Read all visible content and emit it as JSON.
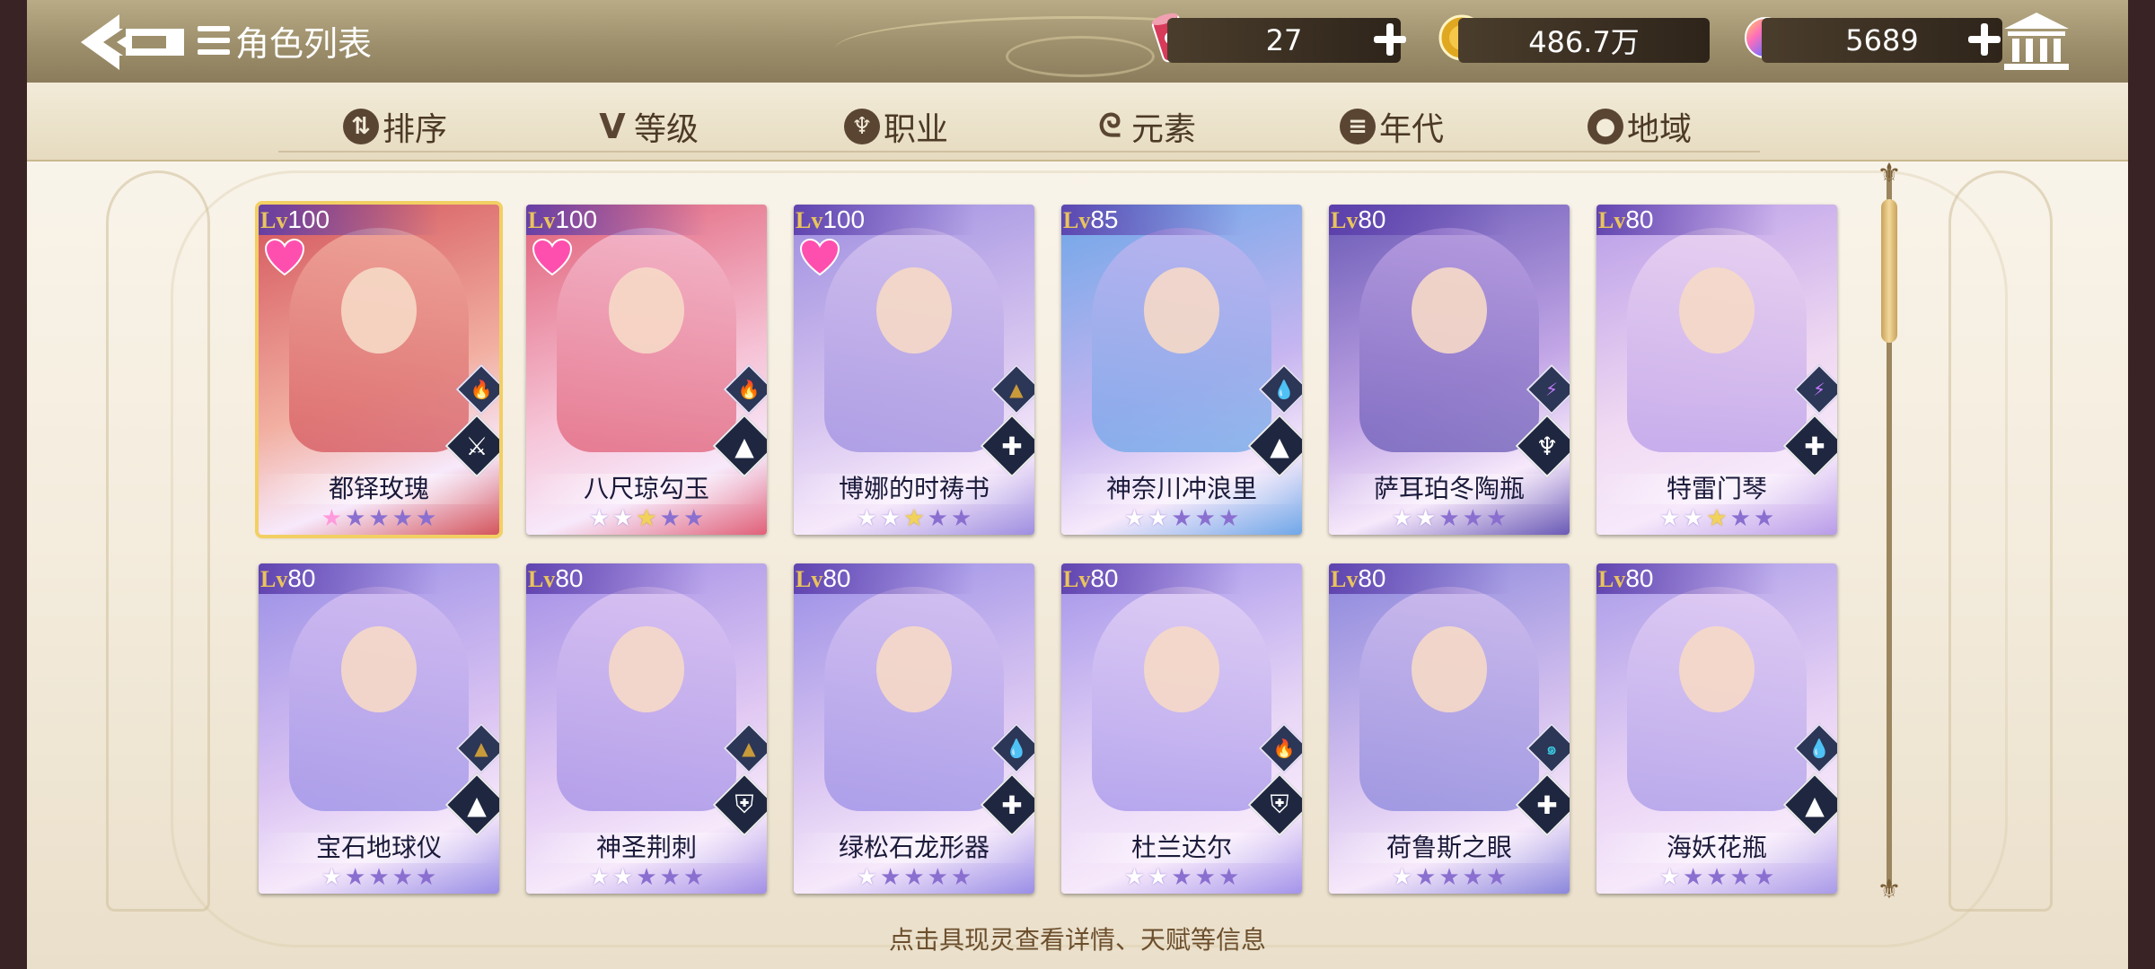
{
  "header": {
    "title": "角色列表",
    "resources": [
      {
        "icon": "stamina-can-icon",
        "value": "27"
      },
      {
        "icon": "gold-coin-icon",
        "value": "486.7万"
      },
      {
        "icon": "rainbow-gem-icon",
        "value": "5689"
      }
    ]
  },
  "filters": [
    {
      "label": "排序",
      "icon": "sort-icon"
    },
    {
      "label": "等级",
      "icon": "level-icon"
    },
    {
      "label": "职业",
      "icon": "class-icon"
    },
    {
      "label": "元素",
      "icon": "element-icon"
    },
    {
      "label": "年代",
      "icon": "era-icon"
    },
    {
      "label": "地域",
      "icon": "region-icon"
    }
  ],
  "cards": [
    {
      "lv_prefix": "Lv",
      "lv": "100",
      "name": "都铎玫瑰",
      "favorite": true,
      "element": "fire",
      "class": "sword",
      "stars": [
        "p",
        "d",
        "d",
        "d",
        "d"
      ],
      "palette": [
        "#d4555c",
        "#f2b0a2"
      ]
    },
    {
      "lv_prefix": "Lv",
      "lv": "100",
      "name": "八尺琼勾玉",
      "favorite": true,
      "element": "fire",
      "class": "book",
      "stars": [
        "w",
        "w",
        "y",
        "d",
        "d"
      ],
      "palette": [
        "#e06078",
        "#f6c3d6"
      ]
    },
    {
      "lv_prefix": "Lv",
      "lv": "100",
      "name": "博娜的时祷书",
      "favorite": true,
      "element": "earth",
      "class": "cross",
      "stars": [
        "w",
        "w",
        "y",
        "d",
        "d"
      ],
      "palette": [
        "#9e8ee0",
        "#d8c6f0"
      ]
    },
    {
      "lv_prefix": "Lv",
      "lv": "85",
      "name": "神奈川冲浪里",
      "favorite": false,
      "element": "water",
      "class": "book",
      "stars": [
        "w",
        "w",
        "d",
        "d",
        "d"
      ],
      "palette": [
        "#6fa7e8",
        "#c6b5f0"
      ]
    },
    {
      "lv_prefix": "Lv",
      "lv": "80",
      "name": "萨耳珀冬陶瓶",
      "favorite": false,
      "element": "thunder",
      "class": "trident",
      "stars": [
        "w",
        "w",
        "d",
        "d",
        "d"
      ],
      "palette": [
        "#6a5ab6",
        "#c2a6e6"
      ]
    },
    {
      "lv_prefix": "Lv",
      "lv": "80",
      "name": "特雷门琴",
      "favorite": false,
      "element": "thunder",
      "class": "cross",
      "stars": [
        "w",
        "w",
        "y",
        "d",
        "d"
      ],
      "palette": [
        "#b89ce8",
        "#f0d9f2"
      ]
    },
    {
      "lv_prefix": "Lv",
      "lv": "80",
      "name": "宝石地球仪",
      "favorite": false,
      "element": "earth",
      "class": "book",
      "stars": [
        "w",
        "d",
        "d",
        "d",
        "d"
      ],
      "palette": [
        "#9a8fe6",
        "#d9c2f2"
      ]
    },
    {
      "lv_prefix": "Lv",
      "lv": "80",
      "name": "神圣荆刺",
      "favorite": false,
      "element": "earth",
      "class": "shield",
      "stars": [
        "w",
        "w",
        "d",
        "d",
        "d"
      ],
      "palette": [
        "#a28fe6",
        "#e1c9f3"
      ]
    },
    {
      "lv_prefix": "Lv",
      "lv": "80",
      "name": "绿松石龙形器",
      "favorite": false,
      "element": "water",
      "class": "cross",
      "stars": [
        "w",
        "d",
        "d",
        "d",
        "d"
      ],
      "palette": [
        "#9a8ee6",
        "#dcc8f2"
      ]
    },
    {
      "lv_prefix": "Lv",
      "lv": "80",
      "name": "杜兰达尔",
      "favorite": false,
      "element": "fire",
      "class": "shield",
      "stars": [
        "w",
        "w",
        "d",
        "d",
        "d"
      ],
      "palette": [
        "#a494ea",
        "#e8d6f6"
      ]
    },
    {
      "lv_prefix": "Lv",
      "lv": "80",
      "name": "荷鲁斯之眼",
      "favorite": false,
      "element": "wind",
      "class": "cross",
      "stars": [
        "w",
        "d",
        "d",
        "d",
        "d"
      ],
      "palette": [
        "#8b87dc",
        "#d6c2ef"
      ]
    },
    {
      "lv_prefix": "Lv",
      "lv": "80",
      "name": "海妖花瓶",
      "favorite": false,
      "element": "water",
      "class": "book",
      "stars": [
        "w",
        "d",
        "d",
        "d",
        "d"
      ],
      "palette": [
        "#a99ae8",
        "#e9d3f5"
      ]
    }
  ],
  "hint": "点击具现灵查看详情、天赋等信息"
}
